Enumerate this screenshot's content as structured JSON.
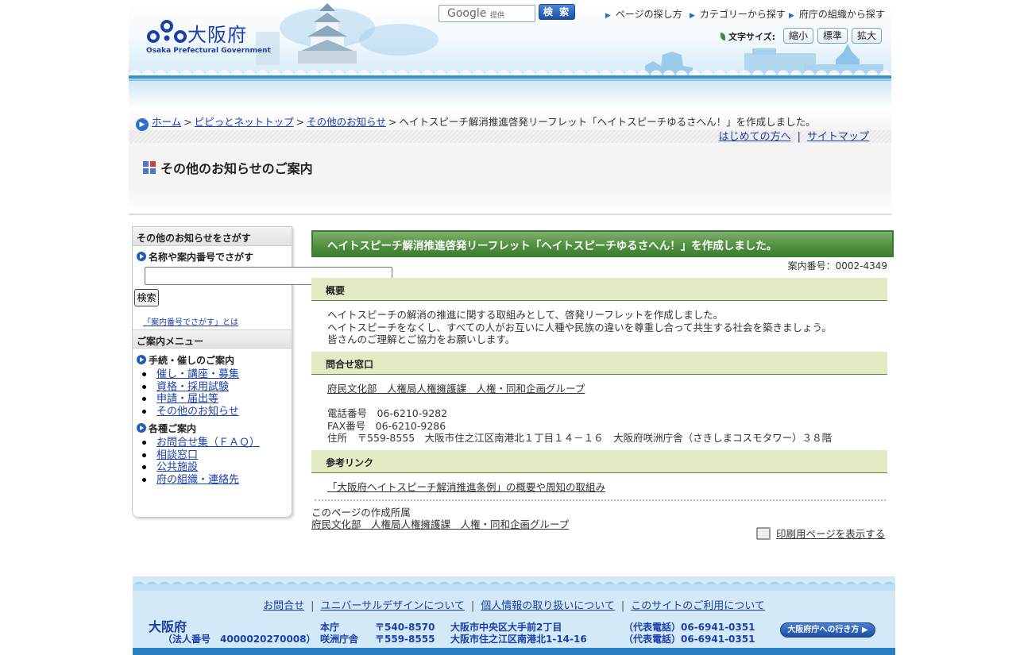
{
  "header": {
    "logo_name": "大阪府",
    "logo_en": "Osaka Prefectural Government",
    "search_google": "Google",
    "search_provided": "提供",
    "search_button": "検 索",
    "nav": [
      "ページの探し方",
      "カテゴリーから探す",
      "府庁の組織から探す"
    ],
    "font_size_label": "文字サイズ:",
    "font_small": "縮小",
    "font_standard": "標準",
    "font_large": "拡大"
  },
  "breadcrumb": {
    "items": [
      "ホーム",
      "ピピっとネットトップ",
      "その他のお知らせ"
    ],
    "current": "ヘイトスピーチ解消推進啓発リーフレット「ヘイトスピーチゆるさへん！」を作成しました。",
    "separator": ">"
  },
  "sublinks": [
    "はじめての方へ",
    "サイトマップ"
  ],
  "section_title": "その他のお知らせのご案内",
  "sidebar": {
    "search_head": "その他のお知らせをさがす",
    "search_sub": "名称や案内番号でさがす",
    "search_button": "検索",
    "search_note": "「案内番号でさがす」とは",
    "menu_head": "ご案内メニュー",
    "group1_title": "手続・催しのご案内",
    "group1_items": [
      "催し・講座・募集",
      "資格・採用試験",
      "申請・届出等",
      "その他のお知らせ"
    ],
    "group2_title": "各種ご案内",
    "group2_items": [
      "お問合せ集（ＦＡＱ）",
      "相談窓口",
      "公共施設",
      "府の組織・連絡先"
    ]
  },
  "main": {
    "title": "ヘイトスピーチ解消推進啓発リーフレット「ヘイトスピーチゆるさへん！」を作成しました。",
    "ref_no": "案内番号：0002-4349",
    "overview_head": "概要",
    "overview_lines": [
      "ヘイトスピーチの解消の推進に関する取組みとして、啓発リーフレットを作成しました。",
      "ヘイトスピーチをなくし、すべての人がお互いに人種や民族の違いを尊重し合って共生する社会を築きましょう。",
      "皆さんのご理解とご協力をお願いします。"
    ],
    "contact_head": "問合せ窓口",
    "contact_link": "府民文化部　人権局人権擁護課　人権・同和企画グループ",
    "tel": "電話番号　06-6210-9282",
    "fax": "FAX番号　06-6210-9286",
    "address": "住所　〒559-8555　大阪市住之江区南港北１丁目１４－１６　大阪府咲洲庁舎（さきしまコスモタワー）３８階",
    "links_head": "参考リンク",
    "ref_link": "「大阪府ヘイトスピーチ解消推進条例」の概要や周知の取組み",
    "author_label": "このページの作成所属",
    "author_link": "府民文化部　人権局人権擁護課　人権・同和企画グループ",
    "print_link": "印刷用ページを表示する"
  },
  "footer": {
    "links": [
      "お問合せ",
      "ユニバーサルデザインについて",
      "個人情報の取り扱いについて",
      "このサイトのご利用について"
    ],
    "name": "大阪府",
    "corp_no": "（法人番号　4000020270008）",
    "office1": "本庁",
    "zip1": "〒540-8570",
    "addr1": "大阪市中央区大手前2丁目",
    "tel1": "（代表電話）06-6941-0351",
    "office2": "咲洲庁舎",
    "zip2": "〒559-8555",
    "addr2": "大阪市住之江区南港北1-14-16",
    "tel2": "（代表電話）06-6941-0351",
    "access": "大阪府庁への行き方"
  },
  "colors": {
    "link": "#1a3fa8",
    "title_green": "#4f8f3f",
    "section_bg": "#e2ecc4",
    "footer_bg": "#d3e9f8"
  }
}
